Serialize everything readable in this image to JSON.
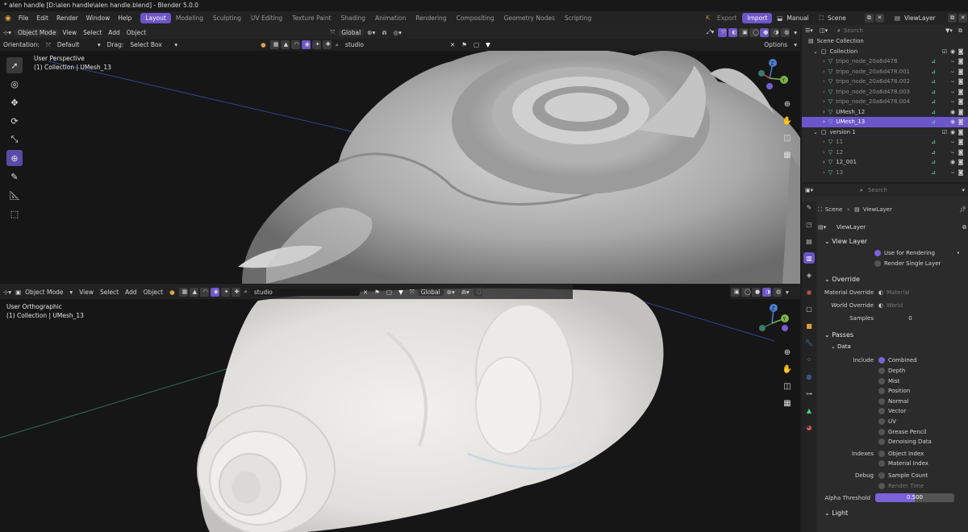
{
  "title_bar": "* alen handle  [D:\\alen handle\\alen handle.blend] - Blender 5.0.0",
  "menu": [
    "File",
    "Edit",
    "Render",
    "Window",
    "Help"
  ],
  "workspaces": [
    "Layout",
    "Modeling",
    "Sculpting",
    "UV Editing",
    "Texture Paint",
    "Shading",
    "Animation",
    "Rendering",
    "Compositing",
    "Geometry Nodes",
    "Scripting"
  ],
  "top_right": {
    "export": "Export",
    "import": "Import",
    "manual": "Manual",
    "scene": "Scene",
    "view_layer": "ViewLayer"
  },
  "viewport_top": {
    "mode": "Object Mode",
    "menus": [
      "View",
      "Select",
      "Add",
      "Object"
    ],
    "orientation_label": "Orientation:",
    "orientation": "Default",
    "drag_label": "Drag:",
    "drag": "Select Box",
    "search": "studio",
    "transform": "Global",
    "options": "Options",
    "perspective": "User Perspective",
    "collection": "(1) Collection | UMesh_13"
  },
  "viewport_bottom": {
    "mode": "Object Mode",
    "menus": [
      "View",
      "Select",
      "Add",
      "Object"
    ],
    "search": "studio",
    "transform": "Global",
    "perspective": "User Orthographic",
    "collection": "(1) Collection | UMesh_13"
  },
  "outliner": {
    "search_placeholder": "Search",
    "root": "Scene Collection",
    "rows": [
      {
        "name": "Collection",
        "kind": "collection"
      },
      {
        "name": "tripo_node_20a6d478",
        "kind": "mesh",
        "dim": true
      },
      {
        "name": "tripo_node_20a6d478.001",
        "kind": "mesh",
        "dim": true
      },
      {
        "name": "tripo_node_20a6d478.002",
        "kind": "mesh",
        "dim": true
      },
      {
        "name": "tripo_node_20a6d478.003",
        "kind": "mesh",
        "dim": true
      },
      {
        "name": "tripo_node_20a6d478.004",
        "kind": "mesh",
        "dim": true
      },
      {
        "name": "UMesh_12",
        "kind": "mesh"
      },
      {
        "name": "UMesh_13",
        "kind": "mesh",
        "selected": true
      },
      {
        "name": "version 1",
        "kind": "collection"
      },
      {
        "name": "11",
        "kind": "mesh",
        "dim": true
      },
      {
        "name": "12",
        "kind": "mesh",
        "dim": true
      },
      {
        "name": "12_001",
        "kind": "mesh"
      },
      {
        "name": "13",
        "kind": "mesh",
        "dim": true
      }
    ]
  },
  "properties": {
    "search_placeholder": "Search",
    "breadcrumb": [
      "Scene",
      "ViewLayer"
    ],
    "view_layer_name": "ViewLayer",
    "section_view_layer": "View Layer",
    "use_for_rendering": "Use for Rendering",
    "render_single_layer": "Render Single Layer",
    "section_override": "Override",
    "material_override_label": "Material Override",
    "material_override": "Material",
    "world_override_label": "World Override",
    "world_override": "World",
    "samples_label": "Samples",
    "samples_value": "0",
    "section_passes": "Passes",
    "subsection_data": "Data",
    "include_label": "Include",
    "include_items": [
      {
        "label": "Combined",
        "on": true
      },
      {
        "label": "Depth",
        "on": false
      },
      {
        "label": "Mist",
        "on": false
      },
      {
        "label": "Position",
        "on": false
      },
      {
        "label": "Normal",
        "on": false
      },
      {
        "label": "Vector",
        "on": false
      },
      {
        "label": "UV",
        "on": false
      },
      {
        "label": "Grease Pencil",
        "on": false
      },
      {
        "label": "Denoising Data",
        "on": false
      }
    ],
    "indexes_label": "Indexes",
    "indexes_items": [
      {
        "label": "Object Index",
        "on": false
      },
      {
        "label": "Material Index",
        "on": false
      }
    ],
    "debug_label": "Debug",
    "debug_items": [
      {
        "label": "Sample Count",
        "on": false
      },
      {
        "label": "Render Time",
        "on": false
      }
    ],
    "alpha_threshold_label": "Alpha Threshold",
    "alpha_threshold_value": "0.500",
    "section_light": "Light"
  },
  "colors": {
    "accent": "#7054c9",
    "selected_row": "#6c56cc",
    "viewport_bg": "#161616",
    "mesh": "#bdbdbd"
  }
}
